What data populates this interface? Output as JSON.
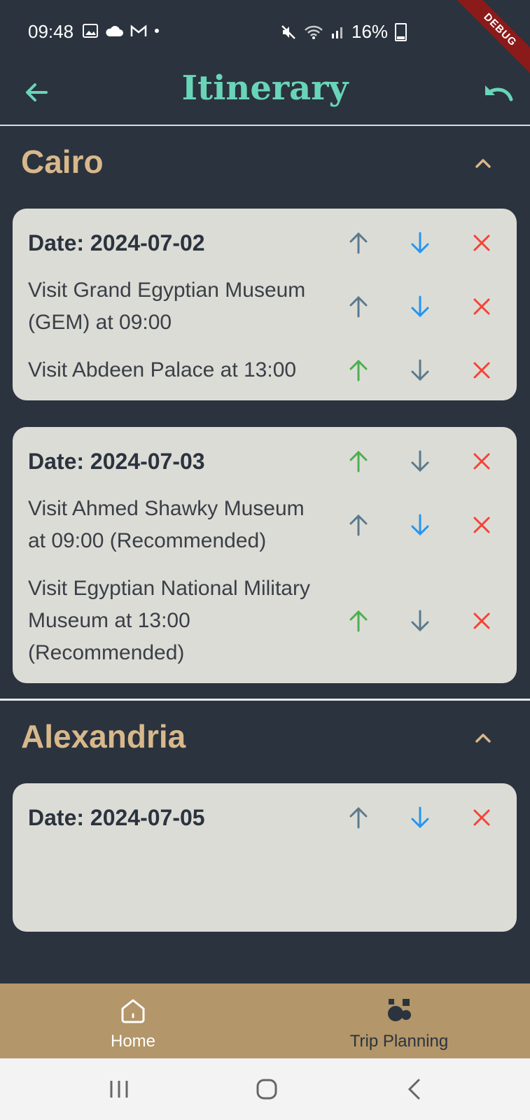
{
  "status_bar": {
    "time": "09:48",
    "battery": "16%"
  },
  "debug_banner": "DEBUG",
  "app_bar": {
    "title": "Itinerary"
  },
  "cities": [
    {
      "name": "Cairo",
      "days": [
        {
          "date_label": "Date: 2024-07-02",
          "activities": [
            "Visit Grand Egyptian Museum (GEM) at 09:00",
            "Visit Abdeen Palace at 13:00"
          ]
        },
        {
          "date_label": "Date: 2024-07-03",
          "activities": [
            "Visit Ahmed Shawky Museum at 09:00 (Recommended)",
            "Visit Egyptian National Military Museum at 13:00 (Recommended)"
          ]
        }
      ]
    },
    {
      "name": "Alexandria",
      "days": [
        {
          "date_label": "Date: 2024-07-05",
          "activities": []
        }
      ]
    }
  ],
  "bottom_nav": {
    "home_label": "Home",
    "trip_label": "Trip Planning"
  },
  "colors": {
    "up_active": "#4caf50",
    "up_muted": "#5b7a8c",
    "down_active": "#2196f3",
    "down_muted": "#5b7a8c",
    "delete": "#f44336",
    "city": "#d8b88b",
    "title": "#69d5b8"
  }
}
